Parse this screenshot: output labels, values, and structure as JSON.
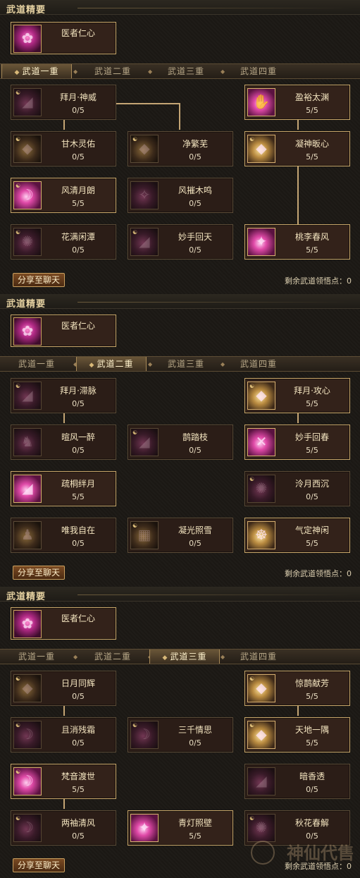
{
  "section_title": "武道精要",
  "essence": {
    "name": "医者仁心"
  },
  "tabs": [
    "武道一重",
    "武道二重",
    "武道三重",
    "武道四重"
  ],
  "share_label": "分享至聊天",
  "remaining_label": "剩余武道领悟点：",
  "remaining_value": "0",
  "watermark": "神仙代售",
  "panels": [
    {
      "active_tab": 0,
      "skills": [
        {
          "name": "拜月·神威",
          "points": "0/5"
        },
        {
          "name": "盈裕太渊",
          "points": "5/5"
        },
        {
          "name": "甘木灵佑",
          "points": "0/5"
        },
        {
          "name": "净繁芜",
          "points": "0/5"
        },
        {
          "name": "凝神昄心",
          "points": "5/5"
        },
        {
          "name": "风清月朗",
          "points": "5/5"
        },
        {
          "name": "风摧木鸣",
          "points": "0/5"
        },
        {
          "name": "花满闲潭",
          "points": "0/5"
        },
        {
          "name": "妙手回天",
          "points": "0/5"
        },
        {
          "name": "桃李春风",
          "points": "5/5"
        }
      ]
    },
    {
      "active_tab": 1,
      "skills": [
        {
          "name": "拜月·滞脉",
          "points": "0/5"
        },
        {
          "name": "拜月·攻心",
          "points": "5/5"
        },
        {
          "name": "暄风一醉",
          "points": "0/5"
        },
        {
          "name": "鹊踏枝",
          "points": "0/5"
        },
        {
          "name": "妙手回春",
          "points": "5/5"
        },
        {
          "name": "疏桐绊月",
          "points": "5/5"
        },
        {
          "name": "泠月西沉",
          "points": "0/5"
        },
        {
          "name": "唯我自在",
          "points": "0/5"
        },
        {
          "name": "凝光照雪",
          "points": "0/5"
        },
        {
          "name": "气定神闲",
          "points": "5/5"
        }
      ]
    },
    {
      "active_tab": 2,
      "skills": [
        {
          "name": "日月同辉",
          "points": "0/5"
        },
        {
          "name": "惊鹊献芳",
          "points": "5/5"
        },
        {
          "name": "且消残霜",
          "points": "0/5"
        },
        {
          "name": "三千情思",
          "points": "0/5"
        },
        {
          "name": "天地一隅",
          "points": "5/5"
        },
        {
          "name": "梵音渡世",
          "points": "5/5"
        },
        {
          "name": "暗香透",
          "points": "0/5"
        },
        {
          "name": "两袖清风",
          "points": "0/5"
        },
        {
          "name": "青灯照壁",
          "points": "5/5"
        },
        {
          "name": "秋花春解",
          "points": "0/5"
        }
      ]
    }
  ]
}
